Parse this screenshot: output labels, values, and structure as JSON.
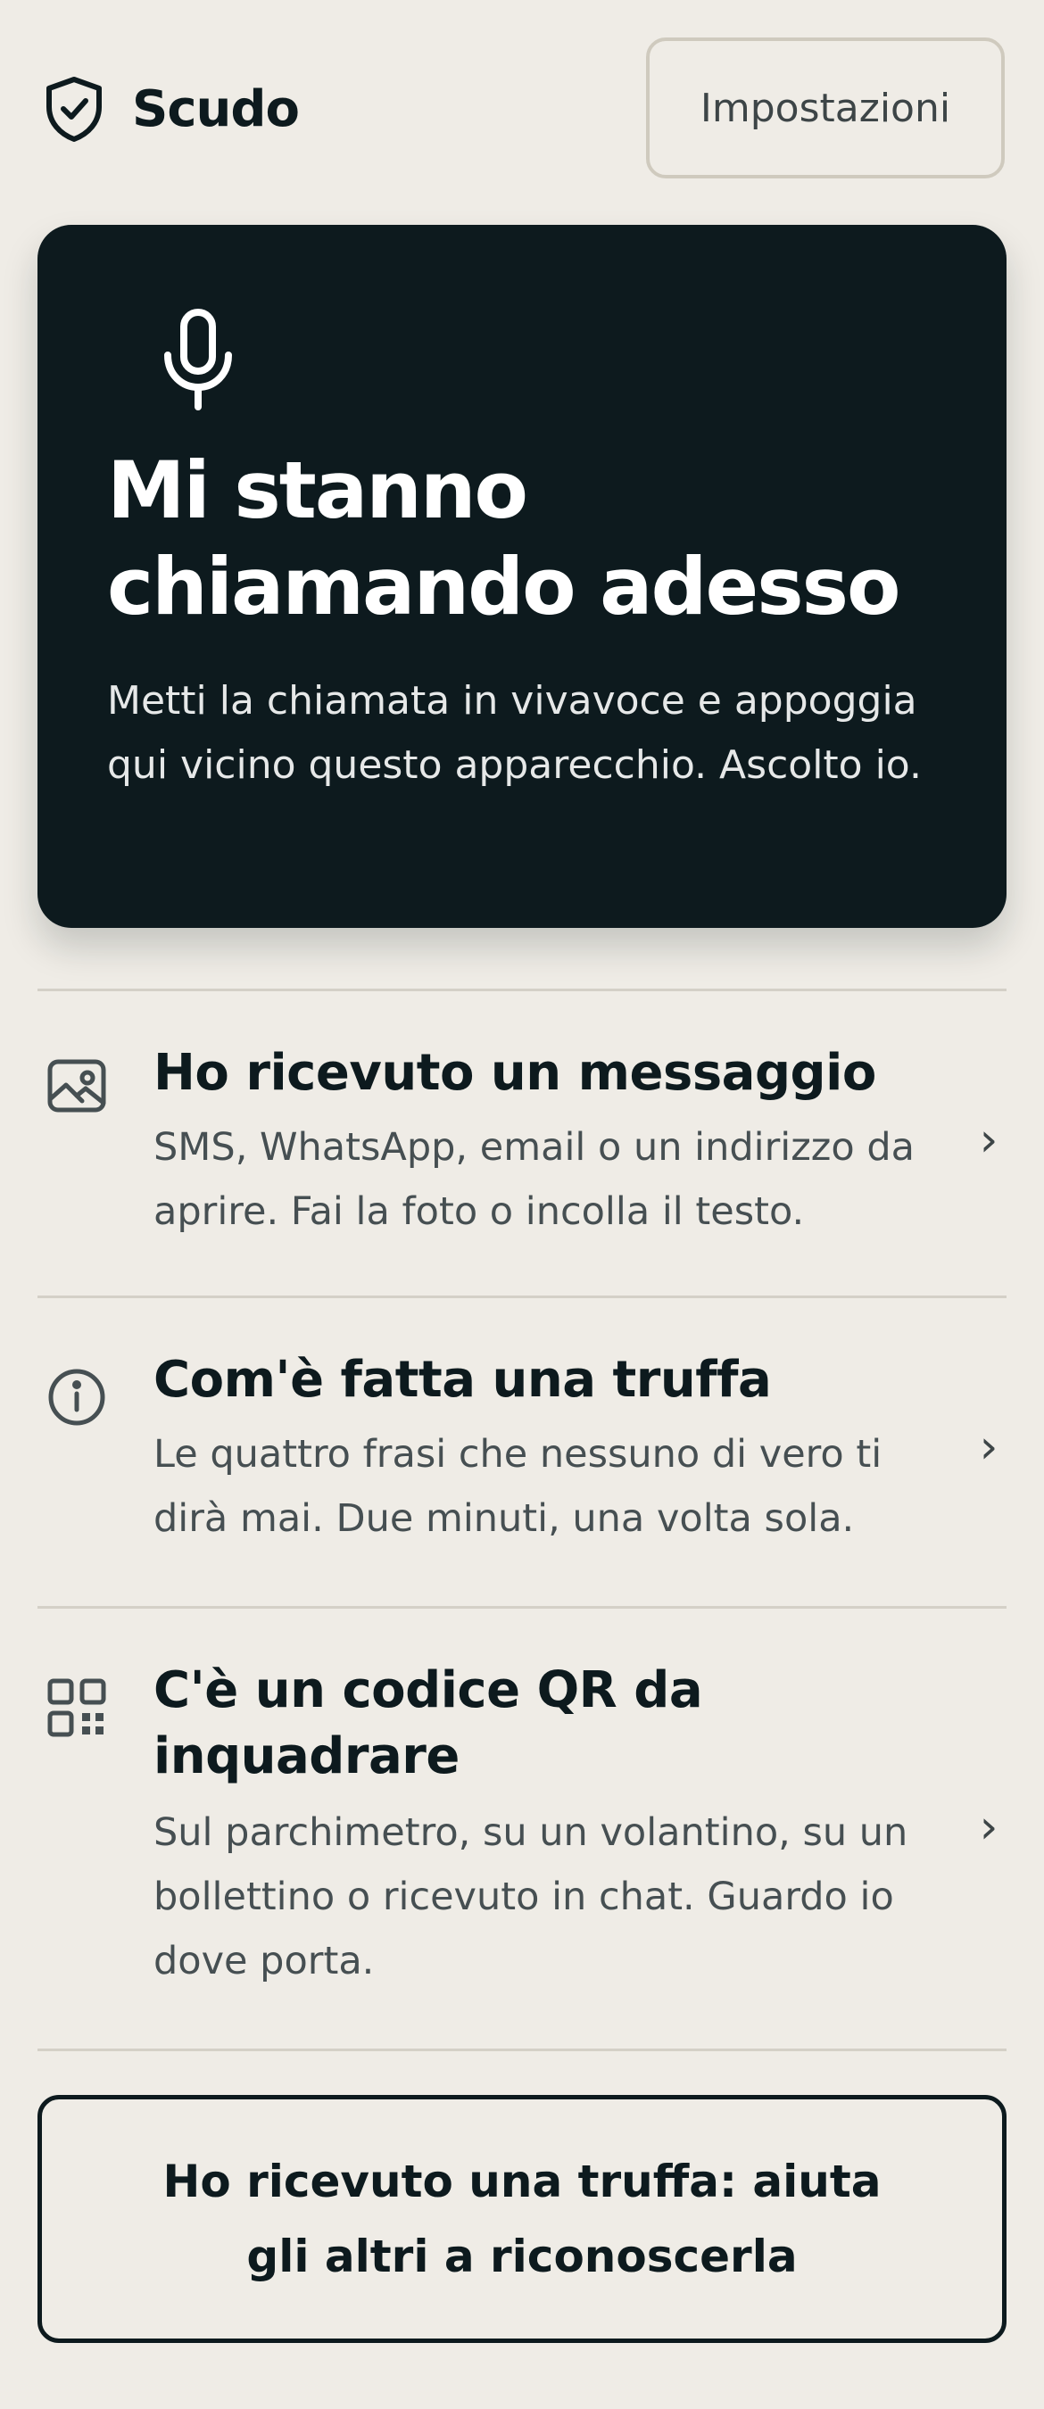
{
  "header": {
    "app_name": "Scudo",
    "logo_icon": "shield-check-icon",
    "settings_label": "Impostazioni"
  },
  "hero": {
    "icon": "microphone-icon",
    "title": "Mi stanno chiamando adesso",
    "description": "Metti la chiamata in vivavoce e appoggia qui vicino questo apparecchio. Ascolto io."
  },
  "actions": [
    {
      "icon": "image-icon",
      "title": "Ho ricevuto un messaggio",
      "description": "SMS, WhatsApp, email o un indirizzo da aprire. Fai la foto o incolla il testo.",
      "chevron": "›"
    },
    {
      "icon": "info-icon",
      "title": "Com'è fatta una truffa",
      "description": "Le quattro frasi che nessuno di vero ti dirà mai. Due minuti, una volta sola.",
      "chevron": "›"
    },
    {
      "icon": "qr-code-icon",
      "title": "C'è un codice QR da inquadrare",
      "description": "Sul parchimetro, su un volantino, su un bollettino o ricevuto in chat. Guardo io dove porta.",
      "chevron": "›"
    }
  ],
  "report": {
    "label": "Ho ricevuto una truffa: aiuta gli altri a riconoscerla"
  },
  "colors": {
    "background": "#efece6",
    "dark": "#0d1a1e",
    "muted_text": "#464f52",
    "border": "#cfcabe"
  }
}
